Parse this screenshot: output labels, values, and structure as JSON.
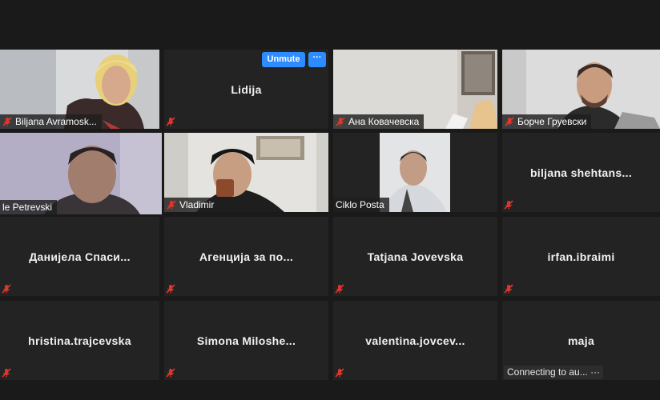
{
  "colors": {
    "active_border": "#b8d735",
    "muted_red": "#e0352b",
    "accent_blue": "#2d8cff"
  },
  "participants": [
    {
      "name": "Biljana Avramosk...",
      "video": true,
      "muted": true
    },
    {
      "name": "Lidija",
      "video": false,
      "muted": true,
      "hover_actions": {
        "unmute": "Unmute",
        "more": "···"
      }
    },
    {
      "name": "Ана Ковачевска",
      "video": true,
      "muted": true
    },
    {
      "name": "Борче Груевски",
      "video": true,
      "muted": true
    },
    {
      "name": "le Petrevski",
      "video": true,
      "muted": false,
      "active_speaker": true
    },
    {
      "name": "Vladimir",
      "video": true,
      "muted": true
    },
    {
      "name": "Ciklo Posta",
      "video": true,
      "muted": false
    },
    {
      "name": "biljana shehtans...",
      "video": false,
      "muted": true
    },
    {
      "name": "Данијела Спаси...",
      "video": false,
      "muted": true
    },
    {
      "name": "Агенција за по...",
      "video": false,
      "muted": true
    },
    {
      "name": "Tatjana Jovevska",
      "video": false,
      "muted": true
    },
    {
      "name": "irfan.ibraimi",
      "video": false,
      "muted": true
    },
    {
      "name": "hristina.trajcevska",
      "video": false,
      "muted": true
    },
    {
      "name": "Simona Miloshe...",
      "video": false,
      "muted": true
    },
    {
      "name": "valentina.jovcev...",
      "video": false,
      "muted": true
    },
    {
      "name": "maja",
      "video": false,
      "muted": false,
      "status": "Connecting to au... ···"
    }
  ]
}
